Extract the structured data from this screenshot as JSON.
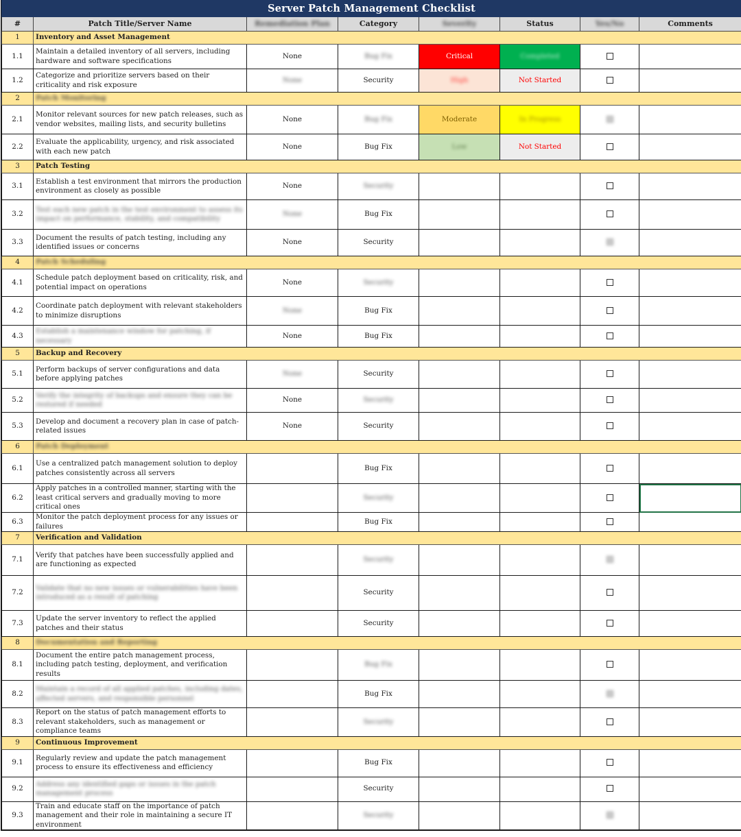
{
  "title": "Server Patch Management Checklist",
  "columns": {
    "num": "#",
    "title": "Patch Title/Server Name",
    "remediation": "Remediation Plan",
    "category": "Category",
    "severity": "Severity",
    "status": "Status",
    "yesno": "Yes/No",
    "comments": "Comments"
  },
  "blurred_columns": [
    "remediation",
    "severity",
    "yesno"
  ],
  "colors": {
    "title_bg": "#1f3864",
    "header_bg": "#d9d9d9",
    "section_bg": "#ffe699",
    "critical": "#ff0000",
    "high": "#fce4d6",
    "moderate": "#ffd966",
    "low": "#c6e0b4",
    "completed": "#00b050",
    "not_started": "#ededed",
    "in_progress": "#ffff00",
    "selection": "#217346"
  },
  "sections": [
    {
      "num": "1",
      "title": "Inventory and Asset Management",
      "blurred": false,
      "items": [
        {
          "num": "1.1",
          "title": "Maintain a detailed inventory of all servers, including hardware and software specifications",
          "title_blurred": false,
          "remediation": "None",
          "remediation_blurred": false,
          "category": "Bug Fix",
          "category_blurred": true,
          "severity": "Critical",
          "severity_class": "sev-critical",
          "severity_blurred": false,
          "status": "Completed",
          "status_class": "st-completed",
          "status_blurred": true,
          "checked": false,
          "check_blurred": false,
          "comments": ""
        },
        {
          "num": "1.2",
          "title": "Categorize and prioritize servers based on their criticality and risk exposure",
          "title_blurred": false,
          "remediation": "None",
          "remediation_blurred": true,
          "category": "Security",
          "category_blurred": false,
          "severity": "High",
          "severity_class": "sev-high",
          "severity_blurred": true,
          "status": "Not Started",
          "status_class": "st-notstarted",
          "status_blurred": false,
          "checked": false,
          "check_blurred": false,
          "comments": ""
        }
      ]
    },
    {
      "num": "2",
      "title": "Patch Monitoring",
      "blurred": true,
      "items": [
        {
          "num": "2.1",
          "title": "Monitor relevant sources for new patch releases, such as vendor websites, mailing lists, and security bulletins",
          "title_blurred": false,
          "remediation": "None",
          "remediation_blurred": false,
          "category": "Bug Fix",
          "category_blurred": true,
          "severity": "Moderate",
          "severity_class": "sev-moderate",
          "severity_blurred": false,
          "status": "In Progress",
          "status_class": "st-inprogress",
          "status_blurred": true,
          "checked": false,
          "check_blurred": true,
          "comments": ""
        },
        {
          "num": "2.2",
          "title": "Evaluate the applicability, urgency, and risk associated with each new patch",
          "title_blurred": false,
          "remediation": "None",
          "remediation_blurred": false,
          "category": "Bug Fix",
          "category_blurred": false,
          "severity": "Low",
          "severity_class": "sev-low",
          "severity_blurred": true,
          "status": "Not Started",
          "status_class": "st-notstarted",
          "status_blurred": false,
          "checked": false,
          "check_blurred": false,
          "comments": ""
        }
      ]
    },
    {
      "num": "3",
      "title": "Patch Testing",
      "blurred": false,
      "items": [
        {
          "num": "3.1",
          "title": "Establish a test environment that mirrors the production environment as closely as possible",
          "title_blurred": false,
          "remediation": "None",
          "remediation_blurred": false,
          "category": "Security",
          "category_blurred": true,
          "severity": "",
          "severity_class": "",
          "severity_blurred": false,
          "status": "",
          "status_class": "",
          "status_blurred": false,
          "checked": false,
          "check_blurred": false,
          "comments": ""
        },
        {
          "num": "3.2",
          "title": "Test each new patch in the test environment to assess its impact on performance, stability, and compatibility",
          "title_blurred": true,
          "remediation": "None",
          "remediation_blurred": true,
          "category": "Bug Fix",
          "category_blurred": false,
          "severity": "",
          "severity_class": "",
          "severity_blurred": false,
          "status": "",
          "status_class": "",
          "status_blurred": false,
          "checked": false,
          "check_blurred": false,
          "comments": ""
        },
        {
          "num": "3.3",
          "title": "Document the results of patch testing, including any identified issues or concerns",
          "title_blurred": false,
          "remediation": "None",
          "remediation_blurred": false,
          "category": "Security",
          "category_blurred": false,
          "severity": "",
          "severity_class": "",
          "severity_blurred": false,
          "status": "",
          "status_class": "",
          "status_blurred": false,
          "checked": false,
          "check_blurred": true,
          "comments": ""
        }
      ]
    },
    {
      "num": "4",
      "title": "Patch Scheduling",
      "blurred": true,
      "items": [
        {
          "num": "4.1",
          "title": "Schedule patch deployment based on criticality, risk, and potential impact on operations",
          "title_blurred": false,
          "remediation": "None",
          "remediation_blurred": false,
          "category": "Security",
          "category_blurred": true,
          "severity": "",
          "severity_class": "",
          "severity_blurred": false,
          "status": "",
          "status_class": "",
          "status_blurred": false,
          "checked": false,
          "check_blurred": false,
          "comments": ""
        },
        {
          "num": "4.2",
          "title": "Coordinate patch deployment with relevant stakeholders to minimize disruptions",
          "title_blurred": false,
          "remediation": "None",
          "remediation_blurred": true,
          "category": "Bug Fix",
          "category_blurred": false,
          "severity": "",
          "severity_class": "",
          "severity_blurred": false,
          "status": "",
          "status_class": "",
          "status_blurred": false,
          "checked": false,
          "check_blurred": false,
          "comments": ""
        },
        {
          "num": "4.3",
          "title": "Establish a maintenance window for patching, if necessary",
          "title_blurred": true,
          "remediation": "None",
          "remediation_blurred": false,
          "category": "Bug Fix",
          "category_blurred": false,
          "severity": "",
          "severity_class": "",
          "severity_blurred": false,
          "status": "",
          "status_class": "",
          "status_blurred": false,
          "checked": false,
          "check_blurred": false,
          "comments": ""
        }
      ]
    },
    {
      "num": "5",
      "title": "Backup and Recovery",
      "blurred": false,
      "items": [
        {
          "num": "5.1",
          "title": "Perform backups of server configurations and data before applying patches",
          "title_blurred": false,
          "remediation": "None",
          "remediation_blurred": true,
          "category": "Security",
          "category_blurred": false,
          "severity": "",
          "severity_class": "",
          "severity_blurred": false,
          "status": "",
          "status_class": "",
          "status_blurred": false,
          "checked": false,
          "check_blurred": false,
          "comments": ""
        },
        {
          "num": "5.2",
          "title": "Verify the integrity of backups and ensure they can be restored if needed",
          "title_blurred": true,
          "remediation": "None",
          "remediation_blurred": false,
          "category": "Security",
          "category_blurred": true,
          "severity": "",
          "severity_class": "",
          "severity_blurred": false,
          "status": "",
          "status_class": "",
          "status_blurred": false,
          "checked": false,
          "check_blurred": false,
          "comments": ""
        },
        {
          "num": "5.3",
          "title": "Develop and document a recovery plan in case of patch-related issues",
          "title_blurred": false,
          "remediation": "None",
          "remediation_blurred": false,
          "category": "Security",
          "category_blurred": false,
          "severity": "",
          "severity_class": "",
          "severity_blurred": false,
          "status": "",
          "status_class": "",
          "status_blurred": false,
          "checked": false,
          "check_blurred": false,
          "comments": ""
        }
      ]
    },
    {
      "num": "6",
      "title": "Patch Deployment",
      "blurred": true,
      "items": [
        {
          "num": "6.1",
          "title": "Use a centralized patch management solution to deploy patches consistently across all servers",
          "title_blurred": false,
          "remediation": "",
          "remediation_blurred": false,
          "category": "Bug Fix",
          "category_blurred": false,
          "severity": "",
          "severity_class": "",
          "severity_blurred": false,
          "status": "",
          "status_class": "",
          "status_blurred": false,
          "checked": false,
          "check_blurred": false,
          "comments": ""
        },
        {
          "num": "6.2",
          "title": "Apply patches in a controlled manner, starting with the least critical servers and gradually moving to more critical ones",
          "title_blurred": false,
          "remediation": "",
          "remediation_blurred": false,
          "category": "Security",
          "category_blurred": true,
          "severity": "",
          "severity_class": "",
          "severity_blurred": false,
          "status": "",
          "status_class": "",
          "status_blurred": false,
          "checked": false,
          "check_blurred": false,
          "comments": "",
          "comments_selected": true
        },
        {
          "num": "6.3",
          "title": "Monitor the patch deployment process for any issues or failures",
          "title_blurred": false,
          "remediation": "",
          "remediation_blurred": false,
          "category": "Bug Fix",
          "category_blurred": false,
          "severity": "",
          "severity_class": "",
          "severity_blurred": false,
          "status": "",
          "status_class": "",
          "status_blurred": false,
          "checked": false,
          "check_blurred": false,
          "comments": ""
        }
      ]
    },
    {
      "num": "7",
      "title": "Verification and Validation",
      "blurred": false,
      "items": [
        {
          "num": "7.1",
          "title": "Verify that patches have been successfully applied and are functioning as expected",
          "title_blurred": false,
          "remediation": "",
          "remediation_blurred": false,
          "category": "Security",
          "category_blurred": true,
          "severity": "",
          "severity_class": "",
          "severity_blurred": false,
          "status": "",
          "status_class": "",
          "status_blurred": false,
          "checked": false,
          "check_blurred": true,
          "comments": ""
        },
        {
          "num": "7.2",
          "title": "Validate that no new issues or vulnerabilities have been introduced as a result of patching",
          "title_blurred": true,
          "remediation": "",
          "remediation_blurred": false,
          "category": "Security",
          "category_blurred": false,
          "severity": "",
          "severity_class": "",
          "severity_blurred": false,
          "status": "",
          "status_class": "",
          "status_blurred": false,
          "checked": false,
          "check_blurred": false,
          "comments": ""
        },
        {
          "num": "7.3",
          "title": "Update the server inventory to reflect the applied patches and their status",
          "title_blurred": false,
          "remediation": "",
          "remediation_blurred": false,
          "category": "Security",
          "category_blurred": false,
          "severity": "",
          "severity_class": "",
          "severity_blurred": false,
          "status": "",
          "status_class": "",
          "status_blurred": false,
          "checked": false,
          "check_blurred": false,
          "comments": ""
        }
      ]
    },
    {
      "num": "8",
      "title": "Documentation and Reporting",
      "blurred": true,
      "items": [
        {
          "num": "8.1",
          "title": "Document the entire patch management process, including patch testing, deployment, and verification results",
          "title_blurred": false,
          "remediation": "",
          "remediation_blurred": false,
          "category": "Bug Fix",
          "category_blurred": true,
          "severity": "",
          "severity_class": "",
          "severity_blurred": false,
          "status": "",
          "status_class": "",
          "status_blurred": false,
          "checked": false,
          "check_blurred": false,
          "comments": ""
        },
        {
          "num": "8.2",
          "title": "Maintain a record of all applied patches, including dates, affected servers, and responsible personnel",
          "title_blurred": true,
          "remediation": "",
          "remediation_blurred": false,
          "category": "Bug Fix",
          "category_blurred": false,
          "severity": "",
          "severity_class": "",
          "severity_blurred": false,
          "status": "",
          "status_class": "",
          "status_blurred": false,
          "checked": false,
          "check_blurred": true,
          "comments": ""
        },
        {
          "num": "8.3",
          "title": "Report on the status of patch management efforts to relevant stakeholders, such as management or compliance teams",
          "title_blurred": false,
          "remediation": "",
          "remediation_blurred": false,
          "category": "Security",
          "category_blurred": true,
          "severity": "",
          "severity_class": "",
          "severity_blurred": false,
          "status": "",
          "status_class": "",
          "status_blurred": false,
          "checked": false,
          "check_blurred": false,
          "comments": ""
        }
      ]
    },
    {
      "num": "9",
      "title": "Continuous Improvement",
      "blurred": false,
      "items": [
        {
          "num": "9.1",
          "title": "Regularly review and update the patch management process to ensure its effectiveness and efficiency",
          "title_blurred": false,
          "remediation": "",
          "remediation_blurred": false,
          "category": "Bug Fix",
          "category_blurred": false,
          "severity": "",
          "severity_class": "",
          "severity_blurred": false,
          "status": "",
          "status_class": "",
          "status_blurred": false,
          "checked": false,
          "check_blurred": false,
          "comments": ""
        },
        {
          "num": "9.2",
          "title": "Address any identified gaps or issues in the patch management process",
          "title_blurred": true,
          "remediation": "",
          "remediation_blurred": false,
          "category": "Security",
          "category_blurred": false,
          "severity": "",
          "severity_class": "",
          "severity_blurred": false,
          "status": "",
          "status_class": "",
          "status_blurred": false,
          "checked": false,
          "check_blurred": false,
          "comments": ""
        },
        {
          "num": "9.3",
          "title": "Train and educate staff on the importance of patch management and their role in maintaining a secure IT environment",
          "title_blurred": false,
          "remediation": "",
          "remediation_blurred": false,
          "category": "Security",
          "category_blurred": true,
          "severity": "",
          "severity_class": "",
          "severity_blurred": false,
          "status": "",
          "status_class": "",
          "status_blurred": false,
          "checked": false,
          "check_blurred": true,
          "comments": ""
        }
      ]
    }
  ]
}
